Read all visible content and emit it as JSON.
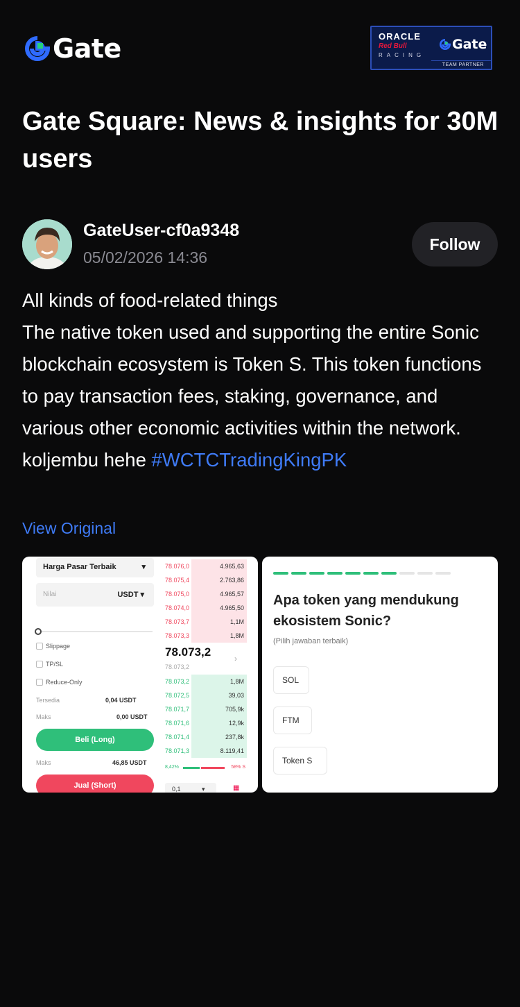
{
  "header": {
    "brand": "Gate",
    "partner": {
      "line1": "ORACLE",
      "line2": "Red Bull",
      "line3": "RACING",
      "brand": "Gate",
      "tag": "TEAM PARTNER"
    }
  },
  "headline": "Gate Square: News & insights for 30M users",
  "post": {
    "username": "GateUser-cf0a9348",
    "timestamp": "05/02/2026 14:36",
    "follow_label": "Follow",
    "line1": "All kinds of food-related things",
    "line2": "The native token used and supporting the entire Sonic blockchain ecosystem is Token S. This token functions to pay transaction fees, staking, governance, and various other economic activities within the network.",
    "line3_text": "koljembu hehe ",
    "hashtag": "#WCTCTradingKingPK",
    "view_original": "View Original"
  },
  "trade_image": {
    "order_type": "Harga Pasar Terbaik",
    "value_placeholder": "Nilai",
    "currency": "USDT",
    "options": [
      "Slippage",
      "TP/SL",
      "Reduce-Only"
    ],
    "available_label": "Tersedia",
    "available_value": "0,04 USDT",
    "max_label": "Maks",
    "max_value": "0,00 USDT",
    "buy_label": "Beli (Long)",
    "max2_label": "Maks",
    "max2_value": "46,85 USDT",
    "sell_label": "Jual (Short)",
    "asks": [
      {
        "price": "78.076,0",
        "qty": "4.965,63"
      },
      {
        "price": "78.075,4",
        "qty": "2.763,86"
      },
      {
        "price": "78.075,0",
        "qty": "4.965,57"
      },
      {
        "price": "78.074,0",
        "qty": "4.965,50"
      },
      {
        "price": "78.073,7",
        "qty": "1,1M"
      },
      {
        "price": "78.073,3",
        "qty": "1,8M"
      }
    ],
    "last_price": "78.073,2",
    "mark_price": "78.073,2",
    "bids": [
      {
        "price": "78.073,2",
        "qty": "1,8M"
      },
      {
        "price": "78.072,5",
        "qty": "39,03"
      },
      {
        "price": "78.071,7",
        "qty": "705,9k"
      },
      {
        "price": "78.071,6",
        "qty": "12,9k"
      },
      {
        "price": "78.071,4",
        "qty": "237,8k"
      },
      {
        "price": "78.071,3",
        "qty": "8.119,41"
      }
    ],
    "buy_pct": "8,42%",
    "sell_pct": "58% S",
    "depth": "0,1"
  },
  "quiz_image": {
    "question": "Apa token yang mendukung ekosistem Sonic?",
    "hint": "(Pilih jawaban terbaik)",
    "options": [
      "SOL",
      "FTM",
      "Token S"
    ]
  }
}
